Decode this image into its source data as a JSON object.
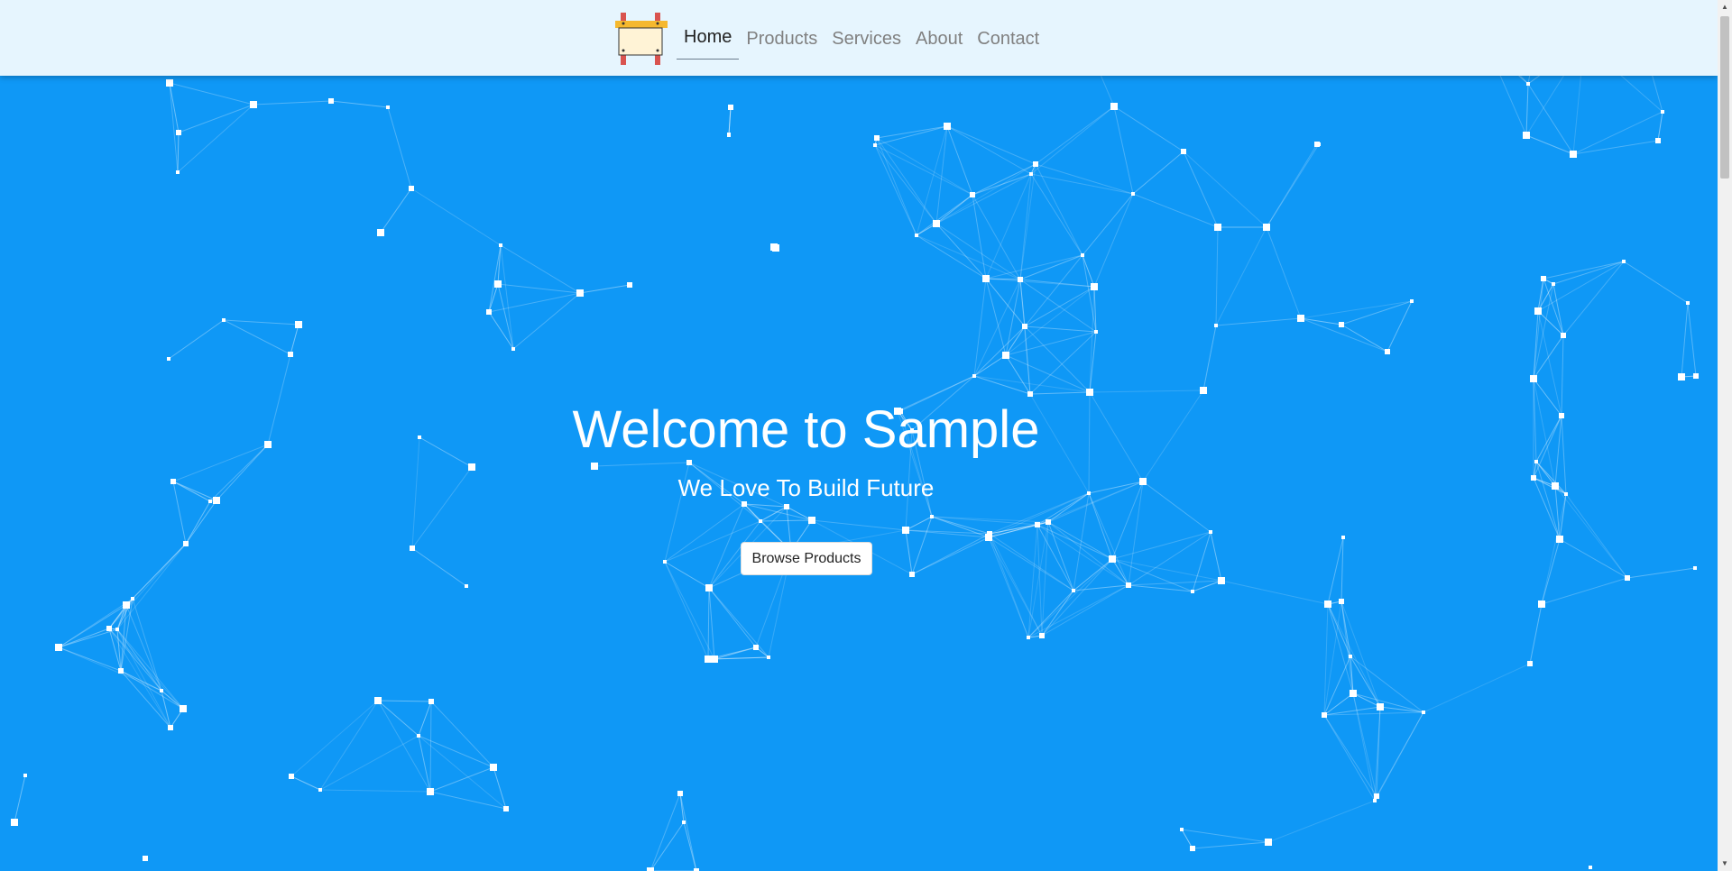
{
  "nav": {
    "logo_icon": "signboard-logo-icon",
    "items": [
      {
        "label": "Home",
        "active": true
      },
      {
        "label": "Products",
        "active": false
      },
      {
        "label": "Services",
        "active": false
      },
      {
        "label": "About",
        "active": false
      },
      {
        "label": "Contact",
        "active": false
      }
    ]
  },
  "hero": {
    "title": "Welcome to Sample",
    "subtitle": "We Love To Build Future",
    "cta_label": "Browse Products"
  },
  "colors": {
    "background": "#0f98f6",
    "navbar": "#e6f5fe",
    "particles": "#ffffff"
  }
}
